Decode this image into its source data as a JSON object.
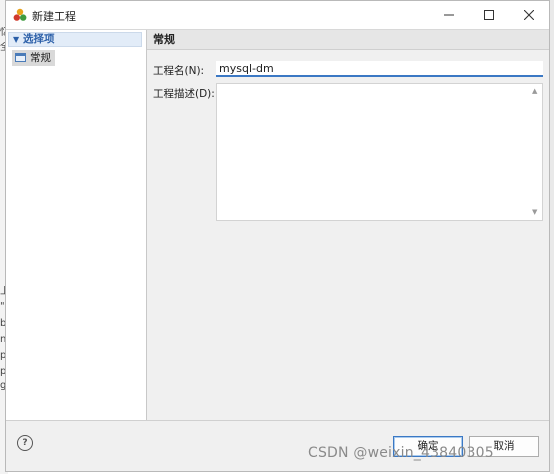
{
  "window": {
    "title": "新建工程"
  },
  "tree": {
    "root_label": "选择项",
    "items": [
      {
        "label": "常规"
      }
    ]
  },
  "section": {
    "header": "常规"
  },
  "form": {
    "name_label": "工程名(N):",
    "name_value": "mysql-dm",
    "desc_label": "工程描述(D):",
    "desc_value": ""
  },
  "footer": {
    "help": "?",
    "ok_label": "确定",
    "cancel_label": "取消"
  },
  "background": {
    "chars": [
      "忆",
      "全",
      "上",
      "\"",
      "b",
      "n",
      "p",
      "p",
      "g"
    ]
  },
  "watermark": "CSDN @weixin_43840305",
  "colors": {
    "accent": "#3b78c4",
    "tree_root_bg": "#e2ecf8",
    "tree_selected_bg": "#d9d9d9"
  }
}
